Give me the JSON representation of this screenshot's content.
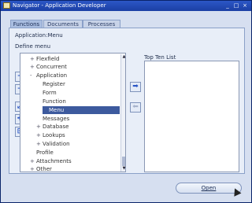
{
  "window": {
    "title": "Navigator - Application Developer"
  },
  "title_buttons": {
    "minimize": "_",
    "maximize": "□",
    "close": "×"
  },
  "tabs": [
    {
      "label": "Functions",
      "active": true
    },
    {
      "label": "Documents",
      "active": false
    },
    {
      "label": "Processes",
      "active": false
    }
  ],
  "breadcrumb": "Application:Menu",
  "define_menu_label": "Define menu",
  "tree": [
    {
      "expander": "+",
      "label": "Flexfield",
      "level": 0
    },
    {
      "expander": "+",
      "label": "Concurrent",
      "level": 0
    },
    {
      "expander": "-",
      "label": "Application",
      "level": 0
    },
    {
      "expander": "",
      "label": "Register",
      "level": 1
    },
    {
      "expander": "",
      "label": "Form",
      "level": 1
    },
    {
      "expander": "",
      "label": "Function",
      "level": 1
    },
    {
      "expander": "",
      "label": "Menu",
      "level": 1,
      "selected": true
    },
    {
      "expander": "",
      "label": "Messages",
      "level": 1
    },
    {
      "expander": "+",
      "label": "Database",
      "level": 1
    },
    {
      "expander": "+",
      "label": "Lookups",
      "level": 1
    },
    {
      "expander": "+",
      "label": "Validation",
      "level": 1
    },
    {
      "expander": "",
      "label": "Profile",
      "level": 0
    },
    {
      "expander": "+",
      "label": "Attachments",
      "level": 0
    },
    {
      "expander": "+",
      "label": "Other",
      "level": 0
    }
  ],
  "scrollbar": {
    "up": "▲",
    "down": "▼"
  },
  "side_buttons": {
    "expand": "+",
    "collapse": "−",
    "expand_branch": "⤢",
    "expand_all": "✚",
    "collapse_all": "⊟"
  },
  "move_buttons": {
    "add": "➡",
    "remove": "⬅"
  },
  "top_ten": {
    "label": "Top Ten List"
  },
  "open_button": {
    "label": "Open"
  },
  "colors": {
    "accent": "#3d5a9e",
    "titlebar": "#1b3fa4"
  }
}
